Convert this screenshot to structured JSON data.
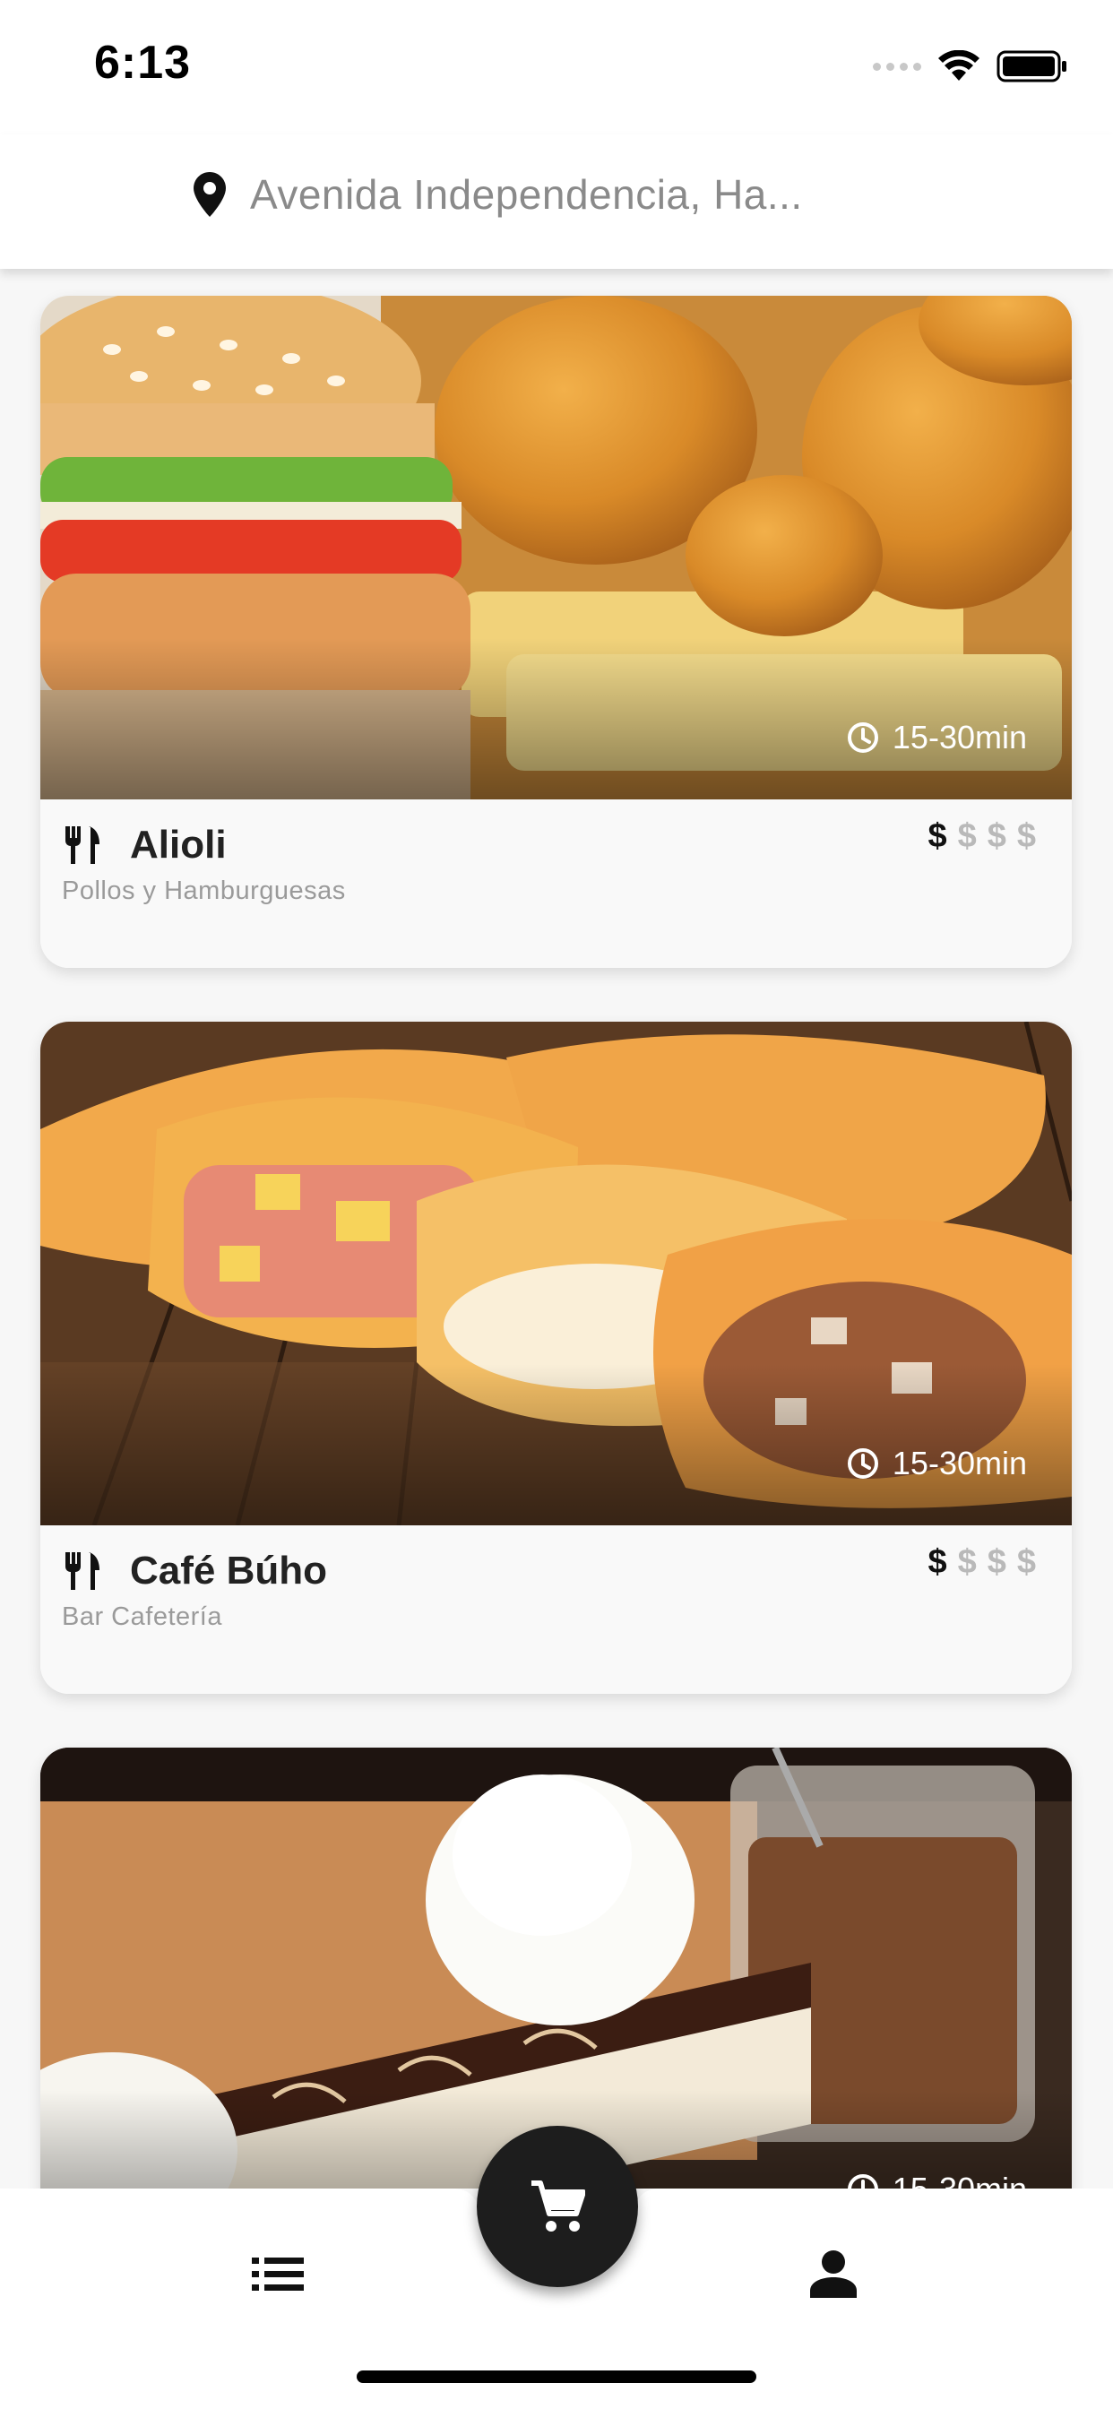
{
  "status_bar": {
    "time": "6:13"
  },
  "header": {
    "location_text": "Avenida Independencia, Ha..."
  },
  "restaurants": [
    {
      "name": "Alioli",
      "category": "Pollos y Hamburguesas",
      "delivery_time": "15-30min",
      "price_level": 1,
      "price_max": 4
    },
    {
      "name": "Café Búho",
      "category": "Bar Cafetería",
      "delivery_time": "15-30min",
      "price_level": 1,
      "price_max": 4
    },
    {
      "name": "",
      "category": "",
      "delivery_time": "15-30min",
      "price_level": 1,
      "price_max": 4
    }
  ],
  "price_symbol": "$",
  "bottom_nav": {
    "items": [
      {
        "icon": "list-icon"
      },
      {
        "icon": "cart-icon"
      },
      {
        "icon": "person-icon"
      }
    ]
  },
  "colors": {
    "background": "#f7f7f7",
    "card_body": "#f9f9f9",
    "fab": "#1d1d1d",
    "price_active": "#111111",
    "price_inactive": "#b9b9b9"
  }
}
